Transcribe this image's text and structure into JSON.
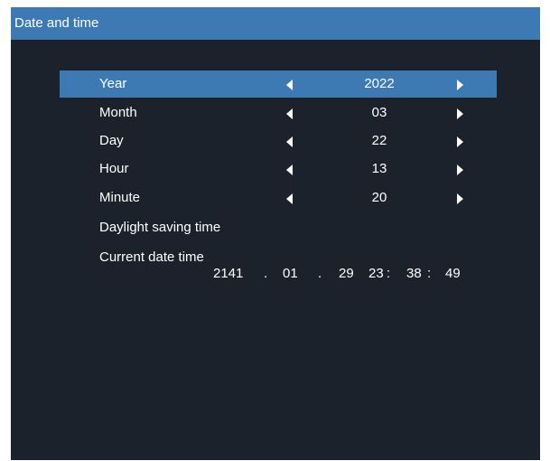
{
  "title": "Date and time",
  "rows": [
    {
      "label": "Year",
      "value": "2022"
    },
    {
      "label": "Month",
      "value": "03"
    },
    {
      "label": "Day",
      "value": "22"
    },
    {
      "label": "Hour",
      "value": "13"
    },
    {
      "label": "Minute",
      "value": "20"
    }
  ],
  "daylight_saving_label": "Daylight saving time",
  "current": {
    "label": "Current date time",
    "year": "2141",
    "sep1": ".",
    "month": "01",
    "sep2": ".",
    "day": "29",
    "hour": "23",
    "colon1": ":",
    "minute": "38",
    "colon2": ":",
    "second": "49"
  },
  "colors": {
    "background": "#1b222b",
    "highlight": "#3d7ab4",
    "text": "#ffffff"
  }
}
